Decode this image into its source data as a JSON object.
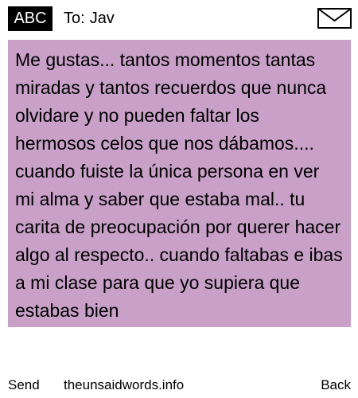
{
  "header": {
    "mode_label": "ABC",
    "to_label": "To:",
    "recipient": "Jav",
    "envelope_icon": "envelope-icon"
  },
  "message": {
    "text": "Me gustas... tantos momentos tantas miradas y tantos recuerdos que nunca olvidare y no pueden faltar los hermosos celos que nos dábamos.... cuando fuiste la única persona en ver mi alma y saber que estaba mal.. tu carita de preocupación por querer hacer algo al respecto.. cuando faltabas e ibas a mi clase para que yo supiera que estabas bien",
    "background_color": "#c8a0c8"
  },
  "footer": {
    "send_label": "Send",
    "site_label": "theunsaidwords.info",
    "back_label": "Back"
  }
}
